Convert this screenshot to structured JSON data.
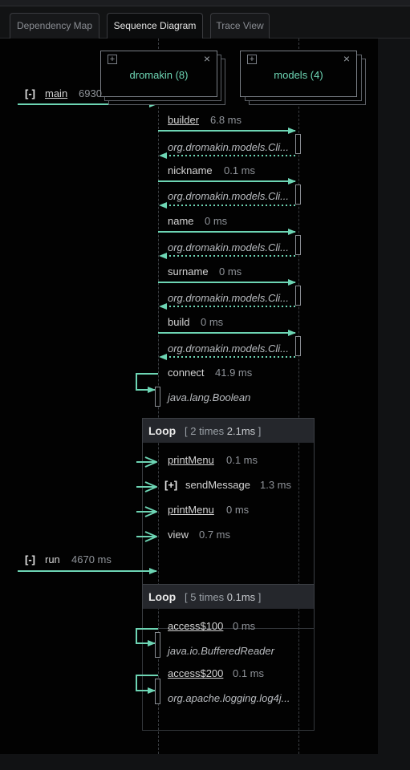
{
  "tabs": [
    {
      "label": "Dependency Map",
      "active": false
    },
    {
      "label": "Sequence Diagram",
      "active": true
    },
    {
      "label": "Trace View",
      "active": false
    }
  ],
  "actors": [
    {
      "label": "dromakin (8)",
      "expand": "+",
      "close": "×"
    },
    {
      "label": "models (4)",
      "expand": "+",
      "close": "×"
    }
  ],
  "entry_calls": [
    {
      "toggle": "[-]",
      "name": "main",
      "time": "6930"
    },
    {
      "toggle": "[-]",
      "name": "run",
      "time": "4670 ms"
    }
  ],
  "messages": [
    {
      "name": "builder",
      "time": "6.8 ms",
      "link": true,
      "return": "org.dromakin.models.Cli..."
    },
    {
      "name": "nickname",
      "time": "0.1 ms",
      "link": false,
      "return": "org.dromakin.models.Cli..."
    },
    {
      "name": "name",
      "time": "0 ms",
      "link": false,
      "return": "org.dromakin.models.Cli..."
    },
    {
      "name": "surname",
      "time": "0 ms",
      "link": false,
      "return": "org.dromakin.models.Cli..."
    },
    {
      "name": "build",
      "time": "0 ms",
      "link": false,
      "return": "org.dromakin.models.Cli..."
    }
  ],
  "self_call": {
    "name": "connect",
    "time": "41.9 ms",
    "return": "java.lang.Boolean"
  },
  "loops": [
    {
      "title": "Loop",
      "count_prefix": "[ 2 times",
      "count_value": "2.1ms",
      "count_suffix": "]",
      "calls": [
        {
          "toggle": "",
          "name": "printMenu",
          "time": "0.1 ms",
          "link": true
        },
        {
          "toggle": "[+]",
          "name": "sendMessage",
          "time": "1.3 ms",
          "link": false
        },
        {
          "toggle": "",
          "name": "printMenu",
          "time": "0 ms",
          "link": true
        },
        {
          "toggle": "",
          "name": "view",
          "time": "0.7 ms",
          "link": false
        }
      ]
    },
    {
      "title": "Loop",
      "count_prefix": "[ 5 times",
      "count_value": "0.1ms",
      "count_suffix": "]",
      "calls": [
        {
          "name": "access$100",
          "time": "0 ms",
          "link": true,
          "return": "java.io.BufferedReader"
        },
        {
          "name": "access$200",
          "time": "0.1 ms",
          "link": true,
          "return": "org.apache.logging.log4j..."
        }
      ]
    }
  ],
  "colors": {
    "arrow": "#6dd5b4",
    "background": "#020202",
    "loop_header": "#25272c"
  }
}
